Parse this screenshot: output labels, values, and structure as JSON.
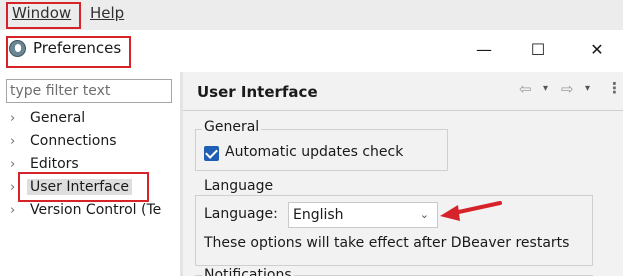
{
  "menubar": {
    "window_label": "Window",
    "help_label": "Help"
  },
  "dialog": {
    "title": "Preferences",
    "minimize_glyph": "—",
    "maximize_glyph": "☐",
    "close_glyph": "✕"
  },
  "filter": {
    "placeholder": "type filter text"
  },
  "tree": {
    "chevron": "›",
    "items": [
      {
        "label": "General"
      },
      {
        "label": "Connections"
      },
      {
        "label": "Editors"
      },
      {
        "label": "User Interface"
      },
      {
        "label": "Version Control (Te"
      }
    ]
  },
  "page": {
    "title": "User Interface",
    "back_glyph": "⇦",
    "forward_glyph": "⇨",
    "dropdown_glyph": "▾",
    "more_glyph": "⋮"
  },
  "general_group": {
    "title": "General",
    "auto_update_label": "Automatic updates check",
    "auto_update_checked": true
  },
  "language_group": {
    "title": "Language",
    "language_label": "Language:",
    "language_value": "English",
    "language_chevron": "⌄",
    "restart_note": "These options will take effect after DBeaver restarts"
  },
  "notifications_group": {
    "title": "Notifications"
  },
  "annotation": {
    "highlight_color": "#d6232a"
  },
  "icons": {
    "app": "dbeaver-icon",
    "back": "back-arrow-icon",
    "forward": "forward-arrow-icon",
    "more": "more-icon"
  }
}
